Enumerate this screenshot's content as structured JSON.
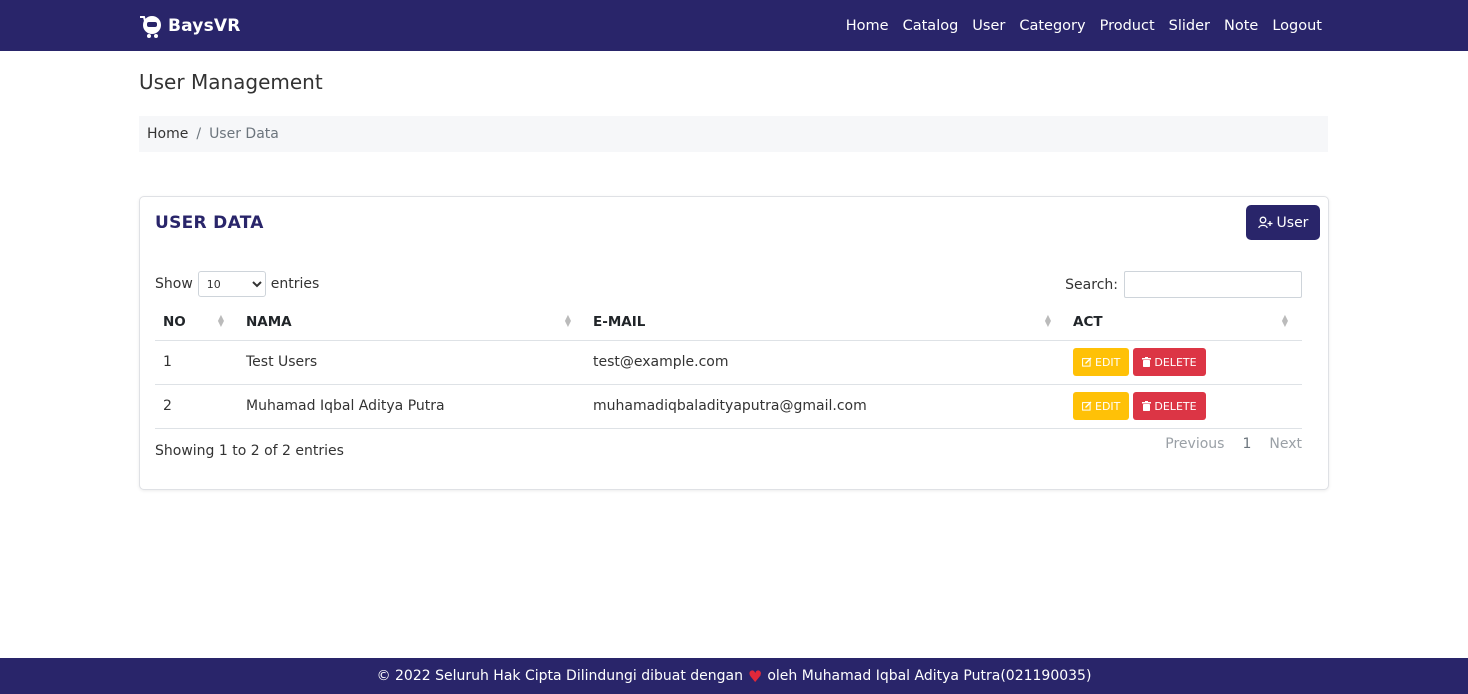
{
  "brand": {
    "name": "BaysVR"
  },
  "nav": [
    "Home",
    "Catalog",
    "User",
    "Category",
    "Product",
    "Slider",
    "Note",
    "Logout"
  ],
  "page": {
    "title": "User Management",
    "breadcrumb": {
      "home": "Home",
      "separator": "/",
      "active": "User Data"
    }
  },
  "card": {
    "title": "USER DATA",
    "add_button_label": "User",
    "length": {
      "show_label": "Show",
      "selected": "10",
      "entries_label": "entries"
    },
    "search": {
      "label": "Search:",
      "value": ""
    },
    "columns": [
      "NO",
      "NAMA",
      "E-MAIL",
      "ACT"
    ],
    "rows": [
      {
        "no": "1",
        "nama": "Test Users",
        "email": "test@example.com"
      },
      {
        "no": "2",
        "nama": "Muhamad Iqbal Aditya Putra",
        "email": "muhamadiqbaladityaputra@gmail.com"
      }
    ],
    "edit_label": "EDIT",
    "delete_label": "DELETE",
    "info": "Showing 1 to 2 of 2 entries",
    "pagination": {
      "previous": "Previous",
      "current": "1",
      "next": "Next"
    }
  },
  "footer": {
    "text_before": "© 2022 Seluruh Hak Cipta Dilindungi dibuat dengan",
    "text_after": "oleh Muhamad Iqbal Aditya Putra(021190035)"
  },
  "colors": {
    "primary": "#29256a",
    "warning": "#ffc107",
    "danger": "#dc3545"
  },
  "icons": {
    "brand": "vr-cart-logo-icon",
    "add_user": "user-plus-icon",
    "edit": "edit-icon",
    "delete": "trash-icon",
    "footer": "heart-icon"
  }
}
